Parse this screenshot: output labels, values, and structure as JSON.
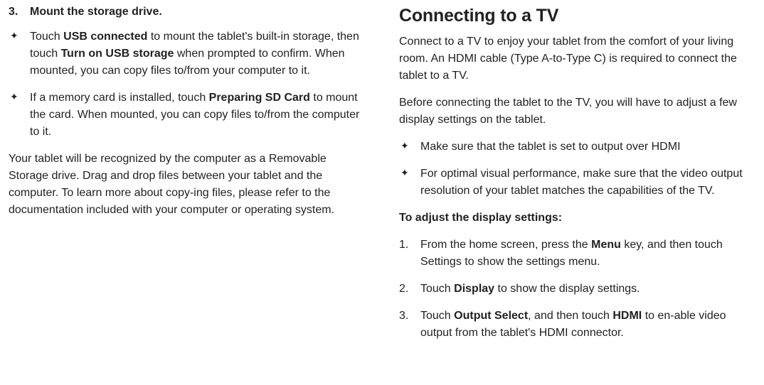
{
  "left": {
    "step": {
      "num": "3.",
      "title": "Mount the storage drive."
    },
    "b1": {
      "pre": "Touch ",
      "bold1": "USB connected",
      "mid": " to mount the tablet's built-in storage, then touch ",
      "bold2": "Turn on USB storage",
      "post": " when prompted to confirm. When mounted, you can copy files to/from your computer to it."
    },
    "b2": {
      "pre": "If a memory card is installed, touch ",
      "bold1": "Preparing SD Card",
      "post": " to mount the card. When mounted, you can copy files to/from the computer to it."
    },
    "para": "Your tablet will be recognized by the computer as a Removable Storage drive. Drag and drop files between your tablet and the computer. To learn more about copy-ing files, please refer to the documentation included with your computer or operating system."
  },
  "right": {
    "title": "Connecting to a TV",
    "p1": "Connect to a TV to enjoy your tablet from the comfort of your living room. An HDMI cable (Type A-to-Type C) is required to connect the tablet to a TV.",
    "p2": "Before connecting the tablet to the TV, you will have to adjust a few display settings on the tablet.",
    "b1": "Make sure that the tablet is set to output over HDMI",
    "b2": "For optimal visual performance, make sure that the video output resolution of your tablet matches the capabilities of the TV.",
    "heading2": "To adjust the display settings:",
    "n1": {
      "num": "1.",
      "pre": "From the home screen, press the ",
      "bold": "Menu",
      "post": " key, and then touch Settings to show the settings menu."
    },
    "n2": {
      "num": "2.",
      "pre": "Touch ",
      "bold": "Display",
      "post": " to show the display settings."
    },
    "n3": {
      "num": "3.",
      "pre": "Touch ",
      "bold1": "Output Select",
      "mid": ", and then touch ",
      "bold2": "HDMI",
      "post": " to en-able video output from the tablet's HDMI connector."
    }
  },
  "icons": {
    "star": "✦"
  }
}
